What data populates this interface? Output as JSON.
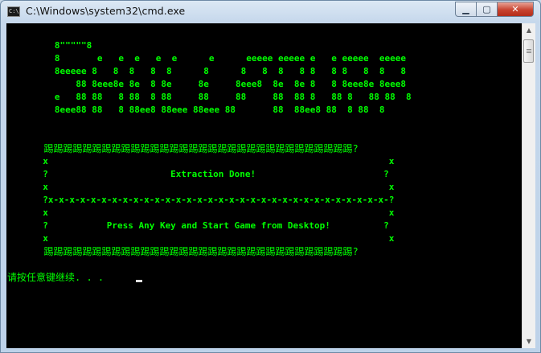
{
  "window": {
    "title": "C:\\Windows\\system32\\cmd.exe",
    "icon_label": "C:\\",
    "minimize_glyph": "▁",
    "maximize_glyph": "▢",
    "close_glyph": "✕"
  },
  "colors": {
    "console_background": "#000000",
    "console_text": "#00ff00",
    "prompt_text": "#00ff00"
  },
  "console": {
    "banner": [
      "   8\"\"\"\"\"8",
      "   8       e   e  e   e  e      e      eeeee eeeee e   e eeeee  eeeee",
      "   8eeeee 8   8  8   8  8      8      8   8  8   8 8   8 8   8  8   8",
      "       88 8eee8e 8e  8 8e     8e     8eee8  8e  8e 8   8 8eee8e 8eee8",
      "   e   88 88   8 88  8 88     88     88     88  88 8   88 8   88 88  8",
      "   8eee88 88   8 88ee8 88eee 88eee 88       88  88ee8 88  8 88  8"
    ],
    "box": [
      "  踢踢踢踢踢踢踢踢踢踢踢踢踢踢踢踢踢踢踢踢踢踢踢踢踢踢踢踢踢踢踢踢?",
      "  x                                                                x",
      "  ?                       Extraction Done!                        ?",
      "  x                                                                x",
      "  ?x-x-x-x-x-x-x-x-x-x-x-x-x-x-x-x-x-x-x-x-x-x-x-x-x-x-x-x-x-x-x-x-?",
      "  x                                                                x",
      "  ?           Press Any Key and Start Game from Desktop!          ?",
      "  x                                                                x",
      "  踢踢踢踢踢踢踢踢踢踢踢踢踢踢踢踢踢踢踢踢踢踢踢踢踢踢踢踢踢踢踢踢?"
    ],
    "prompt": "请按任意键继续. . ."
  },
  "scrollbar": {
    "up_glyph": "▲",
    "down_glyph": "▼"
  }
}
